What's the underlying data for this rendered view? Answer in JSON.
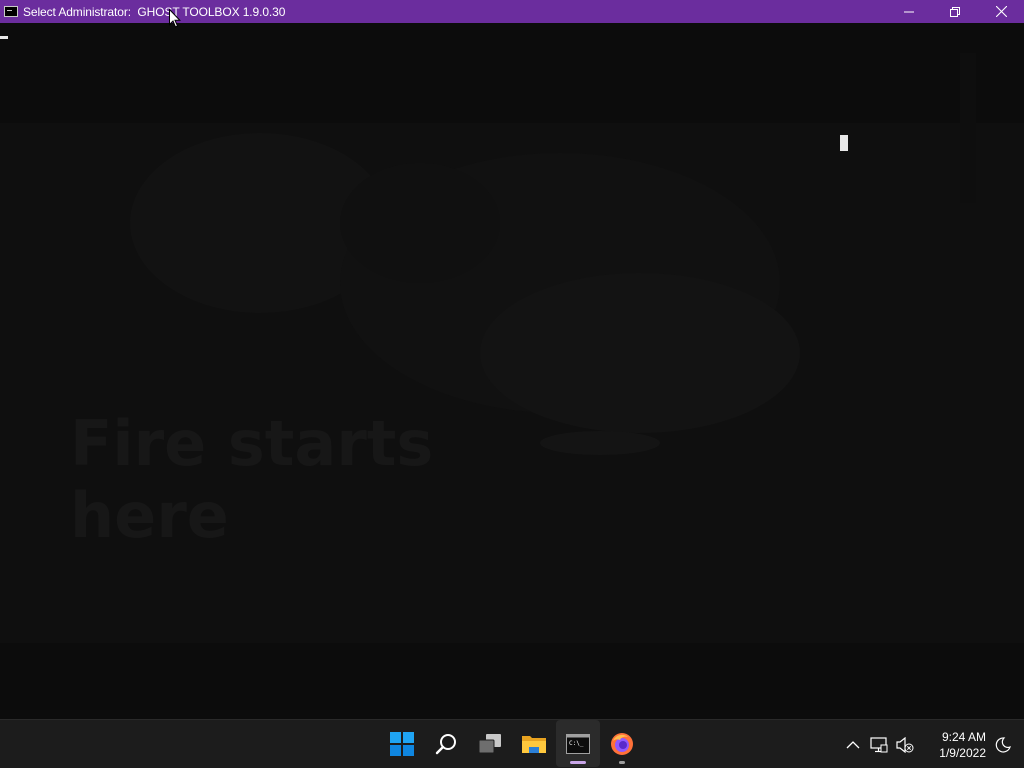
{
  "window": {
    "title": "Select Administrator:  GHOST TOOLBOX 1.9.0.30",
    "controls": [
      "minimize-icon",
      "restore-icon",
      "close-icon"
    ],
    "title_color": "#6b2d9e"
  },
  "console": {
    "background": "#0c0c0c",
    "watermark_text": [
      "Fire starts",
      "here"
    ]
  },
  "taskbar": {
    "apps": [
      {
        "name": "start-button",
        "icon": "windows-logo-icon",
        "active": false,
        "running": false
      },
      {
        "name": "search-button",
        "icon": "search-icon",
        "active": false,
        "running": false
      },
      {
        "name": "task-view-button",
        "icon": "task-view-icon",
        "active": false,
        "running": false
      },
      {
        "name": "file-explorer-button",
        "icon": "folder-icon",
        "active": false,
        "running": false
      },
      {
        "name": "command-prompt-button",
        "icon": "terminal-icon",
        "active": true,
        "running": true
      },
      {
        "name": "firefox-button",
        "icon": "firefox-icon",
        "active": false,
        "running": true
      }
    ],
    "tray": [
      "chevron-up-icon",
      "network-icon",
      "volume-muted-icon",
      "focus-assist-icon"
    ],
    "clock": {
      "time": "9:24 AM",
      "date": "1/9/2022"
    },
    "accent": "#c9a6e8"
  }
}
